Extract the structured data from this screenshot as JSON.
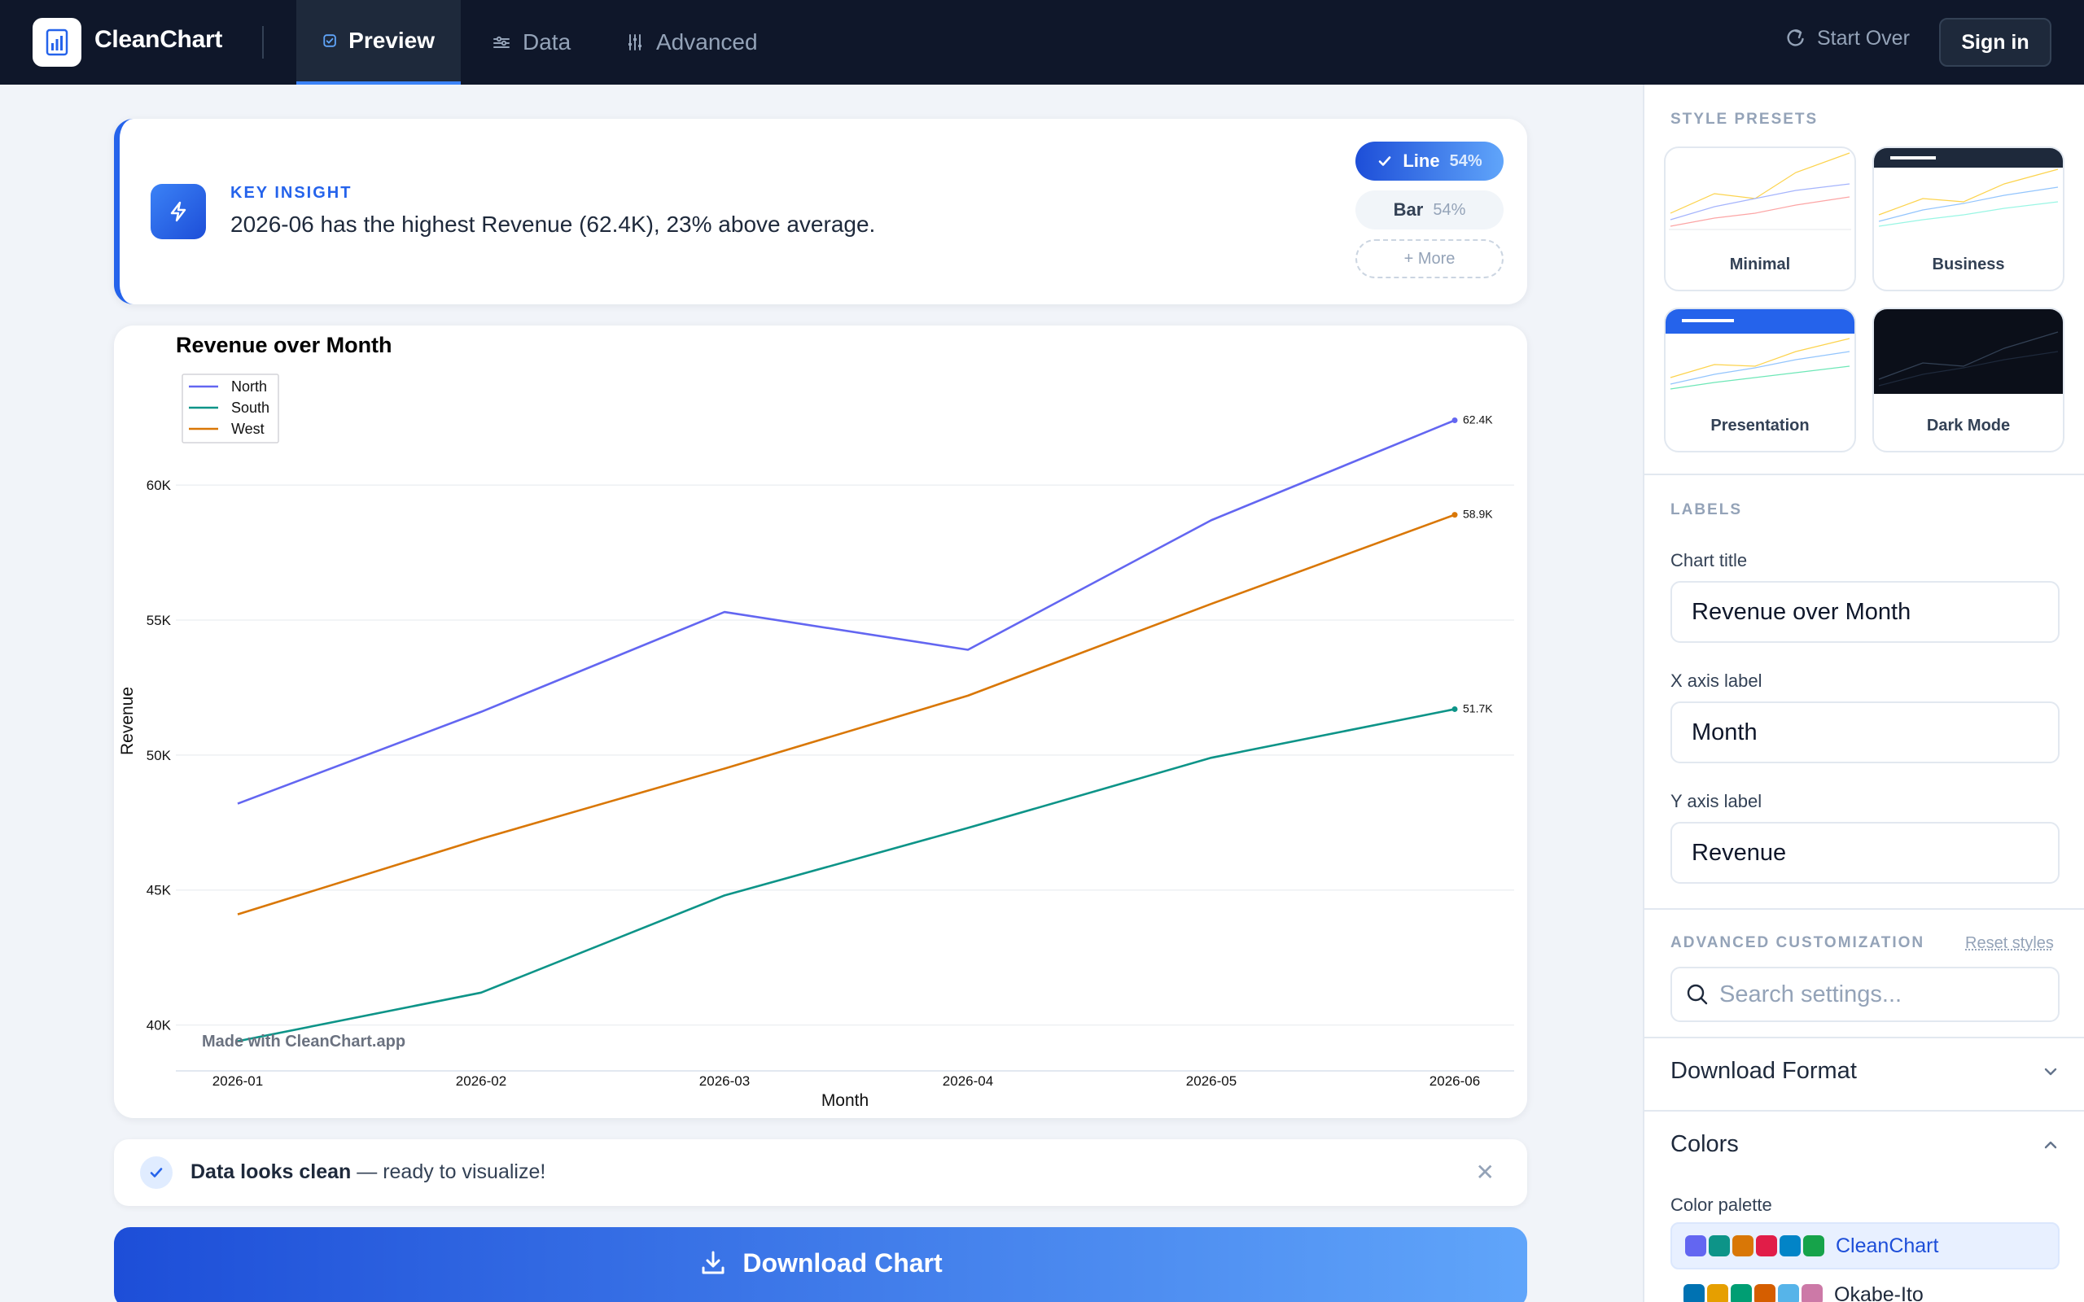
{
  "app": {
    "name": "CleanChart"
  },
  "nav": {
    "tabs": [
      {
        "label": "Preview",
        "active": true,
        "icon": "check-square-icon"
      },
      {
        "label": "Data",
        "active": false,
        "icon": "sliders-horizontal-icon"
      },
      {
        "label": "Advanced",
        "active": false,
        "icon": "sliders-vertical-icon"
      }
    ],
    "start_over": "Start Over",
    "sign_in": "Sign in"
  },
  "insight": {
    "label": "KEY INSIGHT",
    "text": "2026-06 has the highest Revenue (62.4K), 23% above average.",
    "chart_types": [
      {
        "label": "Line",
        "pct": "54%",
        "selected": true
      },
      {
        "label": "Bar",
        "pct": "54%",
        "selected": false
      }
    ],
    "more": "+ More"
  },
  "chart_data": {
    "type": "line",
    "title": "Revenue over Month",
    "xlabel": "Month",
    "ylabel": "Revenue",
    "categories": [
      "2026-01",
      "2026-02",
      "2026-03",
      "2026-04",
      "2026-05",
      "2026-06"
    ],
    "series": [
      {
        "name": "North",
        "color": "#6366f1",
        "values": [
          48200,
          51600,
          55300,
          53900,
          58700,
          62400
        ],
        "end_label": "62.4K"
      },
      {
        "name": "South",
        "color": "#0d9488",
        "values": [
          39400,
          41200,
          44800,
          47300,
          49900,
          51700
        ],
        "end_label": "51.7K"
      },
      {
        "name": "West",
        "color": "#d97706",
        "values": [
          44100,
          46900,
          49500,
          52200,
          55600,
          58900
        ],
        "end_label": "58.9K"
      }
    ],
    "yticks": [
      40000,
      45000,
      50000,
      55000,
      60000
    ],
    "ytick_labels": [
      "40K",
      "45K",
      "50K",
      "55K",
      "60K"
    ],
    "ylim": [
      38300,
      63500
    ],
    "grid": true,
    "legend": "top-left",
    "watermark": "Made with CleanChart.app"
  },
  "status": {
    "bold": "Data looks clean",
    "rest": " — ready to visualize!"
  },
  "download": {
    "label": "Download Chart"
  },
  "panel": {
    "style_presets": {
      "title": "STYLE PRESETS",
      "items": [
        {
          "label": "Minimal"
        },
        {
          "label": "Business"
        },
        {
          "label": "Presentation"
        },
        {
          "label": "Dark Mode"
        }
      ]
    },
    "labels": {
      "title": "LABELS",
      "chart_title_label": "Chart title",
      "chart_title_value": "Revenue over Month",
      "x_label": "X axis label",
      "x_value": "Month",
      "y_label": "Y axis label",
      "y_value": "Revenue"
    },
    "advanced": {
      "title": "ADVANCED CUSTOMIZATION",
      "reset": "Reset styles",
      "search_placeholder": "Search settings..."
    },
    "download_format": {
      "label": "Download Format"
    },
    "colors": {
      "label": "Colors",
      "palette_label": "Color palette",
      "palettes": [
        {
          "name": "CleanChart",
          "selected": true,
          "colors": [
            "#6366f1",
            "#0d9488",
            "#d97706",
            "#e11d48",
            "#0284c7",
            "#16a34a"
          ]
        },
        {
          "name": "Okabe-Ito",
          "selected": false,
          "colors": [
            "#0072b2",
            "#e69f00",
            "#009e73",
            "#d55e00",
            "#56b4e9",
            "#cc79a7"
          ]
        }
      ]
    }
  }
}
